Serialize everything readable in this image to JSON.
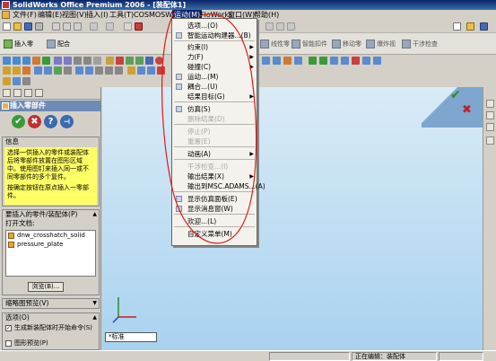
{
  "window": {
    "title": "SolidWorks Office Premium 2006 - [装配体1]"
  },
  "menubar": {
    "items": [
      "文件(F)",
      "编辑(E)",
      "视图(V)",
      "插入(I)",
      "工具(T)",
      "COSMOSWorks",
      "运动(M)",
      "FloWorks",
      "窗口(W)",
      "帮助(H)"
    ],
    "active_index": 6
  },
  "command_toolbar": {
    "buttons": [
      "插入零",
      "配合",
      "线性零",
      "智能扣件",
      "移动零",
      "爆炸视",
      "干涉检查"
    ]
  },
  "motion_menu": {
    "items": [
      {
        "label": "选项...(O)",
        "enabled": true,
        "submenu": false
      },
      {
        "label": "智能运动构建器...(B)",
        "enabled": true,
        "submenu": false
      },
      {
        "label": "约束(I)",
        "enabled": true,
        "submenu": true
      },
      {
        "label": "力(F)",
        "enabled": true,
        "submenu": true
      },
      {
        "label": "碰撞(C)",
        "enabled": true,
        "submenu": true
      },
      {
        "label": "运动...(M)",
        "enabled": true,
        "submenu": false
      },
      {
        "label": "耦合...(U)",
        "enabled": true,
        "submenu": false
      },
      {
        "label": "结果目标(G)",
        "enabled": true,
        "submenu": true
      },
      {
        "label": "仿真(S)",
        "enabled": true,
        "submenu": false
      },
      {
        "label": "删除结果(D)",
        "enabled": false,
        "submenu": false
      },
      {
        "label": "停止(P)",
        "enabled": false,
        "submenu": false
      },
      {
        "label": "重置(E)",
        "enabled": false,
        "submenu": false
      },
      {
        "label": "动画(A)",
        "enabled": true,
        "submenu": true
      },
      {
        "label": "干涉检查...(I)",
        "enabled": false,
        "submenu": false
      },
      {
        "label": "输出结果(X)",
        "enabled": true,
        "submenu": true
      },
      {
        "label": "输出到MSC.ADAMS...(A)",
        "enabled": true,
        "submenu": false
      },
      {
        "label": "显示仿真面板(E)",
        "enabled": true,
        "submenu": false
      },
      {
        "label": "显示消息窗(W)",
        "enabled": true,
        "submenu": false
      },
      {
        "label": "欢迎...(L)",
        "enabled": true,
        "submenu": false
      },
      {
        "label": "自定义菜单(M)",
        "enabled": true,
        "submenu": false
      }
    ]
  },
  "property_manager": {
    "title": "插入零部件",
    "info_title": "信息",
    "info_text": "选择一供插入的零件或装配体后将零部件放置在图形区域中。使用图钉来插入同一或不同零部件的多个复件。",
    "info_text_2": "按确定按钮在原点插入一零部件。",
    "parts_group_title": "要插入的零件/装配体(P)",
    "open_docs_label": "打开文档:",
    "open_docs": [
      "dnw_crosshatch_solid",
      "pressure_plate"
    ],
    "browse_label": "浏览(B)...",
    "preview_group_title": "缩略图预览(V)",
    "options_group_title": "选项(O)",
    "option_1": "生成新装配体时开始命令(S)",
    "option_2": "图形预览(P)"
  },
  "graphics": {
    "model_tab": "*标准"
  },
  "statusbar": {
    "editing_text": "正在编辑：装配体"
  }
}
